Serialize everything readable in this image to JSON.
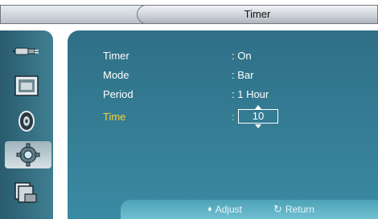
{
  "header": {
    "title": "Timer"
  },
  "sidebar": {
    "items": [
      {
        "icon": "input-plug-icon",
        "active": false
      },
      {
        "icon": "picture-icon",
        "active": false
      },
      {
        "icon": "sound-icon",
        "active": false
      },
      {
        "icon": "setup-gear-icon",
        "active": true
      },
      {
        "icon": "multi-control-icon",
        "active": false
      }
    ]
  },
  "menu": {
    "rows": [
      {
        "label": "Timer",
        "value": ": On"
      },
      {
        "label": "Mode",
        "value": ": Bar"
      },
      {
        "label": "Period",
        "value": ": 1 Hour"
      },
      {
        "label": "Time",
        "value": ":",
        "box_value": "10"
      }
    ]
  },
  "footer": {
    "adjust_label": "Adjust",
    "adjust_glyph": "♦",
    "return_label": "Return",
    "return_glyph": "↻"
  },
  "colors": {
    "panel": "#3a8aa3",
    "sidebar": "#2a5b6e",
    "highlight": "#f3d23a",
    "text": "#ffffff"
  }
}
